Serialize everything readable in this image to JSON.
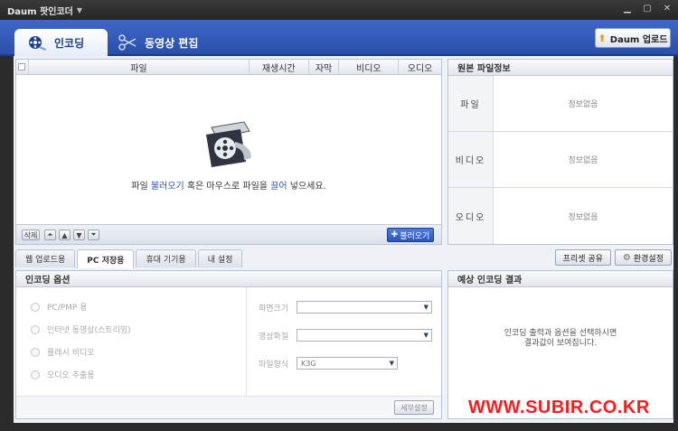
{
  "window": {
    "title": "Daum 팟인코더"
  },
  "main_tabs": [
    {
      "label": "인코딩",
      "active": true
    },
    {
      "label": "동영상 편집",
      "active": false
    }
  ],
  "upload_button": "Daum 업로드",
  "file_list": {
    "columns": [
      "파일",
      "재생시간",
      "자막",
      "비디오",
      "오디오"
    ],
    "empty_message": {
      "before": "파일 ",
      "link1": "불러오기",
      "middle": " 혹은 마우스로 파일을 ",
      "link2": "끌어",
      "after": " 넣으세요."
    },
    "delete_label": "삭제",
    "load_label": "불러오기"
  },
  "source_info": {
    "title": "원본 파일정보",
    "rows": [
      {
        "label": "파일",
        "value": "정보없음"
      },
      {
        "label": "비디오",
        "value": "정보없음"
      },
      {
        "label": "오디오",
        "value": "정보없음"
      }
    ]
  },
  "sub_tabs": [
    {
      "label": "웹 업로드용",
      "active": false
    },
    {
      "label": "PC 저장용",
      "active": true
    },
    {
      "label": "휴대 기기용",
      "active": false
    },
    {
      "label": "내 설정",
      "active": false
    }
  ],
  "right_buttons": {
    "preset_share": "프리셋 공유",
    "settings": "환경설정"
  },
  "encoding_options": {
    "title": "인코딩 옵션",
    "radios": [
      "PC/PMP 용",
      "인터넷 동영상(스트리밍)",
      "플래시 비디오",
      "오디오 추출용"
    ],
    "fields": [
      {
        "label": "화면크기",
        "value": ""
      },
      {
        "label": "영상화질",
        "value": ""
      },
      {
        "label": "파일형식",
        "value": "K3G"
      }
    ],
    "detail_button": "세부설정"
  },
  "result": {
    "title": "예상 인코딩 결과",
    "line1": "인코딩 출력과 옵션을 선택하시면",
    "line2": "결과값이 보여집니다."
  },
  "watermark": "WWW.SUBIR.CO.KR",
  "colors": {
    "accent": "#2d4fb5",
    "watermark": "#ff1a1a"
  }
}
